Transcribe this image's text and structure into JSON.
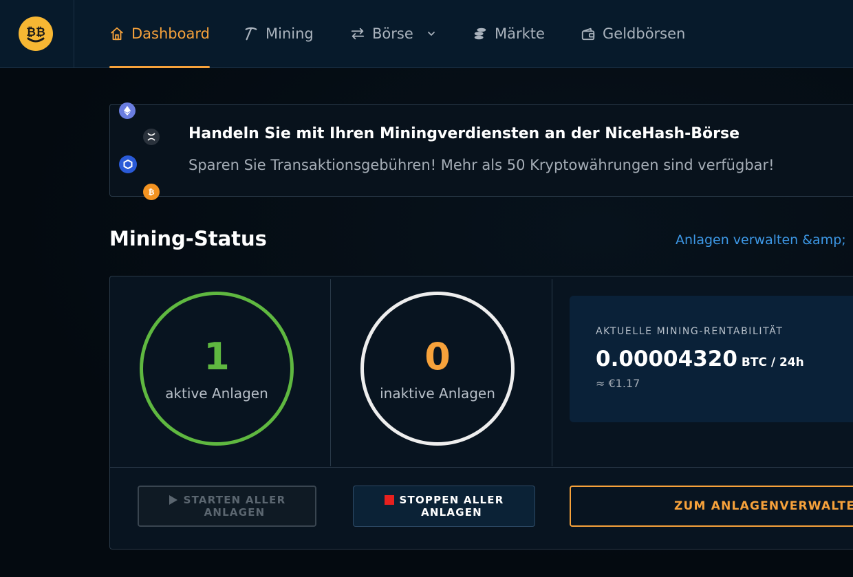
{
  "nav": {
    "items": [
      {
        "label": "Dashboard",
        "icon": "home-icon",
        "active": true
      },
      {
        "label": "Mining",
        "icon": "pickaxe-icon",
        "active": false
      },
      {
        "label": "Börse",
        "icon": "exchange-arrows-icon",
        "active": false,
        "dropdown": true
      },
      {
        "label": "Märkte",
        "icon": "coins-stack-icon",
        "active": false
      },
      {
        "label": "Geldbörsen",
        "icon": "wallet-icon",
        "active": false
      }
    ]
  },
  "banner": {
    "title": "Handeln Sie mit Ihren Miningverdiensten an der NiceHash-Börse",
    "subtitle": "Sparen Sie Transaktionsgebühren! Mehr als 50 Kryptowährungen sind verfügbar!"
  },
  "mining_status": {
    "title": "Mining-Status",
    "manage_link": "Anlagen verwalten &amp;",
    "active": {
      "count": "1",
      "label": "aktive Anlagen"
    },
    "inactive": {
      "count": "0",
      "label": "inaktive Anlagen"
    },
    "profitability": {
      "label": "AKTUELLE MINING-RENTABILITÄT",
      "value": "0.00004320",
      "unit": "BTC / 24h",
      "fiat": "≈ €1.17"
    },
    "buttons": {
      "start_line1": "STARTEN ALLER",
      "start_line2": "ANLAGEN",
      "stop_line1": "STOPPEN ALLER",
      "stop_line2": "ANLAGEN",
      "manage": "ZUM ANLAGENVERWALTE"
    }
  },
  "colors": {
    "accent": "#f7a23b",
    "active_ring": "#5fb840",
    "inactive_ring": "#eeeeee",
    "link": "#3d98e6",
    "stop_square": "#e8201e"
  }
}
